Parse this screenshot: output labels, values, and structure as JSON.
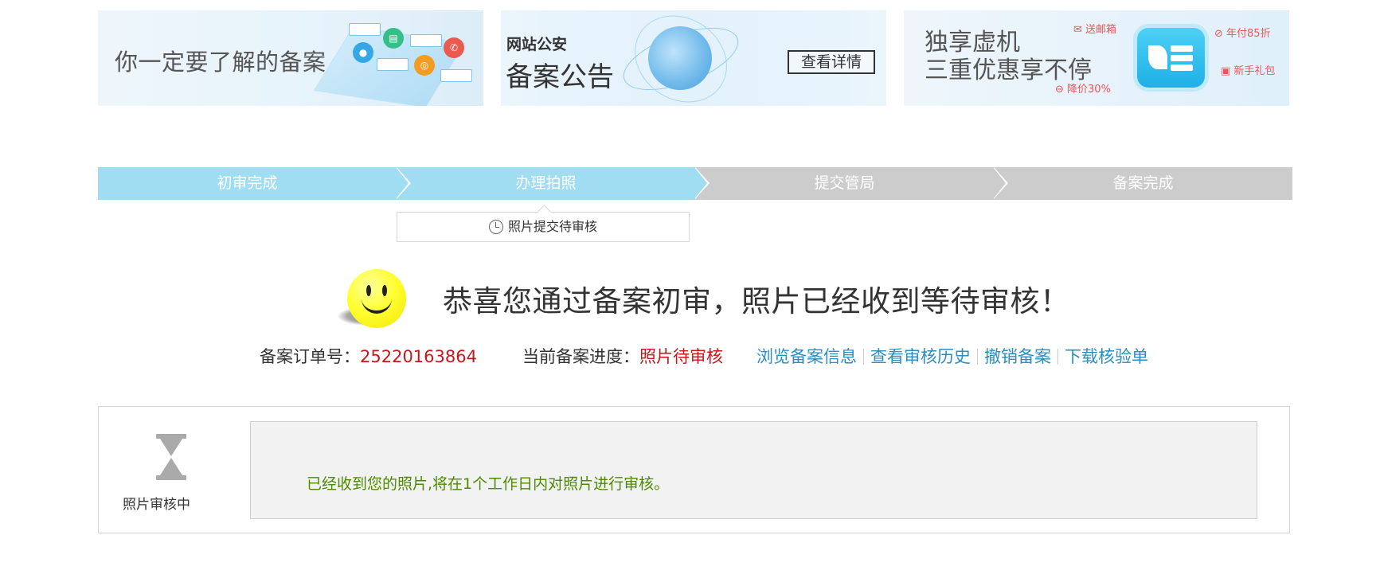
{
  "banners": {
    "b1": {
      "title": "你一定要了解的备案"
    },
    "b2": {
      "sub": "网站公安",
      "title": "备案公告",
      "button": "查看详情"
    },
    "b3": {
      "line1": "独享虚机",
      "line2": "三重优惠享不停",
      "promo1": "送邮箱",
      "promo2": "年付85折",
      "promo3": "新手礼包",
      "promo4": "降价30%"
    }
  },
  "steps": [
    {
      "label": "初审完成",
      "state": "done"
    },
    {
      "label": "办理拍照",
      "state": "done"
    },
    {
      "label": "提交管局",
      "state": "todo"
    },
    {
      "label": "备案完成",
      "state": "todo"
    }
  ],
  "substatus": "照片提交待审核",
  "headline": "恭喜您通过备案初审，照片已经收到等待审核！",
  "order": {
    "label": "备案订单号：",
    "value": "25220163864"
  },
  "progress": {
    "label": "当前备案进度：",
    "value": "照片待审核"
  },
  "links": [
    "浏览备案信息",
    "查看审核历史",
    "撤销备案",
    "下载核验单"
  ],
  "panel": {
    "status_label": "照片审核中",
    "message": "已经收到您的照片,将在1个工作日内对照片进行审核。"
  },
  "colors": {
    "step_done": "#a0ddf3",
    "step_todo": "#cccccc",
    "highlight_red": "#c8161d",
    "link_blue": "#2a8ec1",
    "message_green": "#4d8a00"
  }
}
